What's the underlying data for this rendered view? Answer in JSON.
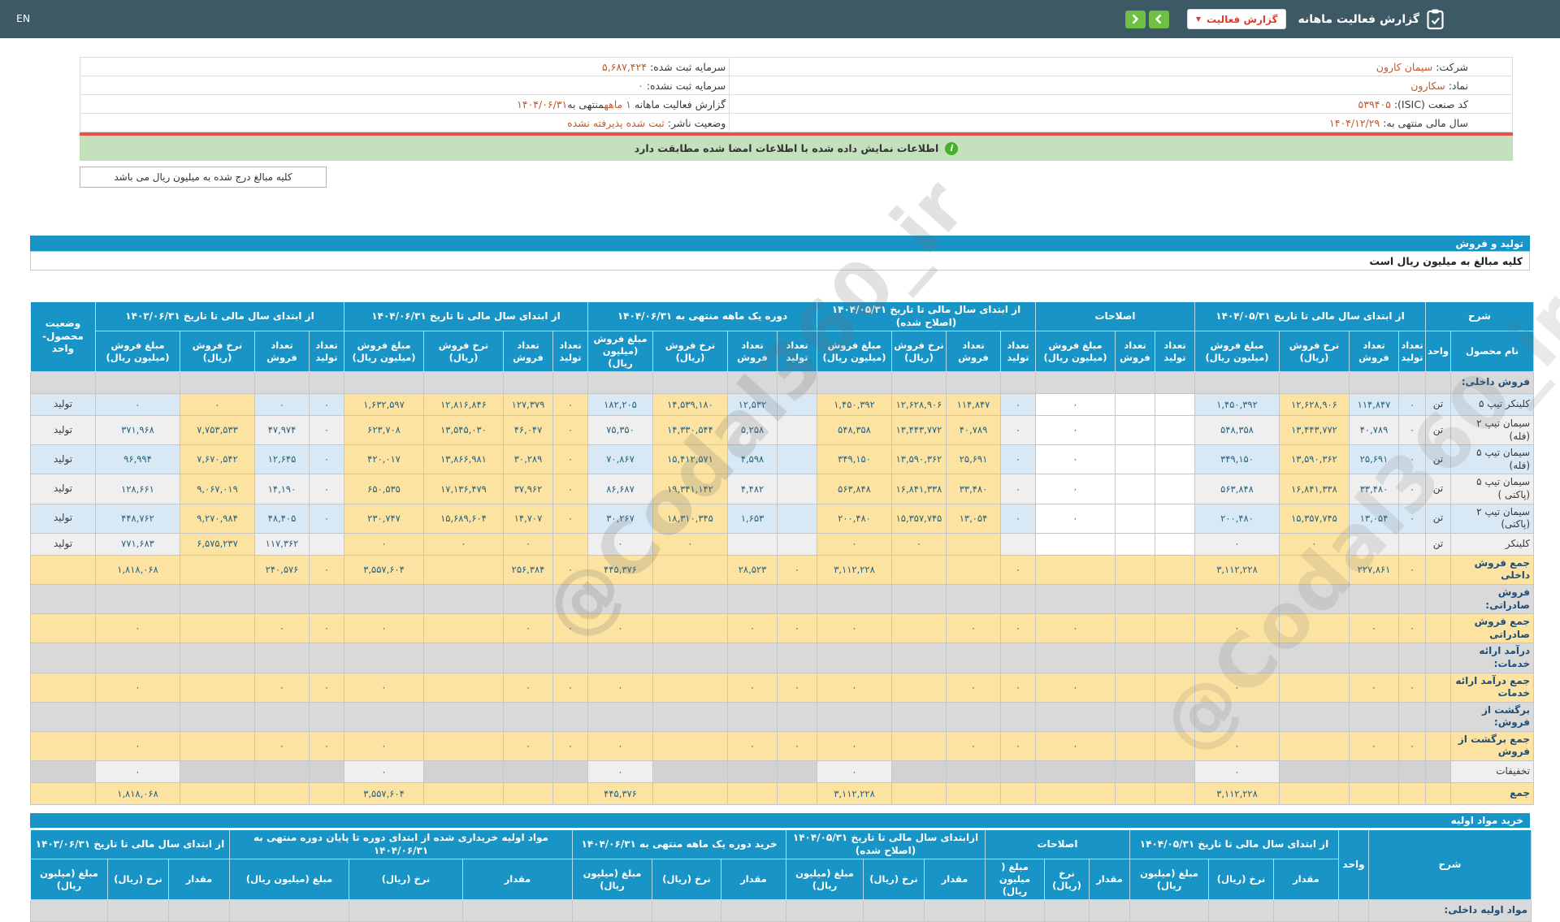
{
  "topbar": {
    "en_label": "EN",
    "title": "گزارش فعالیت ماهانه",
    "dropdown_label": "گزارش فعالیت"
  },
  "info": {
    "company_label": "شرکت:",
    "company_value": "سیمان کارون",
    "symbol_label": "نماد:",
    "symbol_value": "سکارون",
    "isic_label": "کد صنعت (ISIC):",
    "isic_value": "۵۳۹۴۰۵",
    "fiscal_label": "سال مالی منتهی به:",
    "fiscal_value": "۱۴۰۴/۱۲/۲۹",
    "registered_capital_label": "سرمایه ثبت شده:",
    "registered_capital_value": "۵,۶۸۷,۴۲۴",
    "unregistered_capital_label": "سرمایه ثبت نشده:",
    "unregistered_capital_value": "۰",
    "report_label": "گزارش فعالیت ماهانه",
    "report_duration": "۱ ماهه",
    "report_mid": "منتهی به",
    "report_date": "۱۴۰۴/۰۶/۳۱",
    "issuer_status_label": "وضعیت ناشر:",
    "issuer_status_value": "ثبت شده پذیرفته نشده"
  },
  "banner": {
    "text": "اطلاعات نمایش داده شده با اطلاعات امضا شده مطابقت دارد"
  },
  "notes": {
    "amounts_note": "کلیه مبالغ درج شده به میلیون ریال می باشد",
    "table_amounts_note": "کلیه مبالغ به میلیون ریال است"
  },
  "watermark": "@Codal360_ir",
  "colors": {
    "header_blue": "#1994c6",
    "highlight_yellow": "#fce3a1",
    "stripe_blue": "#d8e9f5",
    "stripe_gray": "#efefef",
    "green_button": "#6fbf44",
    "red_accent": "#e0392d",
    "orange_value": "#c35a2e",
    "banner_green": "#c5e0bd",
    "topbar": "#3d5966",
    "red_line": "#e4514f"
  },
  "production_section": {
    "title": "تولید و فروش",
    "header": {
      "desc": "شرح",
      "product": "نام محصول",
      "unit": "واحد",
      "status": "وضعیت محصول-واحد",
      "groups": [
        {
          "label": "از ابتدای سال مالی تا تاریخ ۱۴۰۴/۰۵/۳۱",
          "cols": [
            "تعداد تولید",
            "تعداد فروش",
            "نرخ فروش (ریال)",
            "مبلغ فروش (میلیون ریال)"
          ]
        },
        {
          "label": "اصلاحات",
          "cols": [
            "تعداد تولید",
            "تعداد فروش",
            "مبلغ فروش (میلیون ریال)"
          ]
        },
        {
          "label": "از ابتدای سال مالی تا تاریخ ۱۴۰۴/۰۵/۳۱ (اصلاح شده)",
          "cols": [
            "تعداد تولید",
            "تعداد فروش",
            "نرخ فروش (ریال)",
            "مبلغ فروش (میلیون ریال)"
          ]
        },
        {
          "label": "دوره یک ماهه منتهی به ۱۴۰۴/۰۶/۳۱",
          "cols": [
            "تعداد تولید",
            "تعداد فروش",
            "نرخ فروش (ریال)",
            "مبلغ فروش (میلیون ریال)"
          ]
        },
        {
          "label": "از ابتدای سال مالی تا تاریخ ۱۴۰۴/۰۶/۳۱",
          "cols": [
            "تعداد تولید",
            "تعداد فروش",
            "نرخ فروش (ریال)",
            "مبلغ فروش (میلیون ریال)"
          ]
        },
        {
          "label": "از ابتدای سال مالی تا تاریخ ۱۴۰۳/۰۶/۳۱",
          "cols": [
            "تعداد تولید",
            "تعداد فروش",
            "نرخ فروش (ریال)",
            "مبلغ فروش (میلیون ریال)"
          ]
        }
      ]
    },
    "rows": [
      {
        "type": "section",
        "name": "فروش داخلی:",
        "unit": "",
        "status": "",
        "cells": [
          "",
          "",
          "",
          "",
          "",
          "",
          "",
          "",
          "",
          "",
          "",
          "",
          "",
          "",
          "",
          "",
          "",
          "",
          "",
          "",
          "",
          "",
          ""
        ]
      },
      {
        "type": "product",
        "name": "کلینکر تیپ ۵",
        "unit": "تن",
        "status": "تولید",
        "cells": [
          "۰",
          "۱۱۴,۸۴۷",
          "۱۲,۶۲۸,۹۰۶",
          "۱,۴۵۰,۳۹۲",
          "",
          "",
          "۰",
          "۰",
          "۱۱۴,۸۴۷",
          "۱۲,۶۲۸,۹۰۶",
          "۱,۴۵۰,۳۹۲",
          "",
          "۱۲,۵۳۲",
          "۱۴,۵۳۹,۱۸۰",
          "۱۸۲,۲۰۵",
          "۰",
          "۱۲۷,۳۷۹",
          "۱۲,۸۱۶,۸۴۶",
          "۱,۶۳۲,۵۹۷",
          "۰",
          "۰",
          "۰",
          "۰"
        ]
      },
      {
        "type": "product",
        "name": "سیمان تیپ ۲ (فله)",
        "unit": "تن",
        "status": "تولید",
        "cells": [
          "۰",
          "۴۰,۷۸۹",
          "۱۳,۴۴۳,۷۷۲",
          "۵۴۸,۳۵۸",
          "",
          "",
          "۰",
          "۰",
          "۴۰,۷۸۹",
          "۱۳,۴۴۳,۷۷۲",
          "۵۴۸,۳۵۸",
          "",
          "۵,۲۵۸",
          "۱۴,۳۳۰,۵۴۴",
          "۷۵,۳۵۰",
          "۰",
          "۴۶,۰۴۷",
          "۱۳,۵۴۵,۰۳۰",
          "۶۲۳,۷۰۸",
          "۰",
          "۴۷,۹۷۴",
          "۷,۷۵۳,۵۳۳",
          "۳۷۱,۹۶۸"
        ]
      },
      {
        "type": "product",
        "name": "سیمان تیپ ۵ (فله)",
        "unit": "تن",
        "status": "تولید",
        "cells": [
          "۰",
          "۲۵,۶۹۱",
          "۱۳,۵۹۰,۳۶۲",
          "۳۴۹,۱۵۰",
          "",
          "",
          "۰",
          "۰",
          "۲۵,۶۹۱",
          "۱۳,۵۹۰,۳۶۲",
          "۳۴۹,۱۵۰",
          "",
          "۴,۵۹۸",
          "۱۵,۴۱۲,۵۷۱",
          "۷۰,۸۶۷",
          "۰",
          "۳۰,۲۸۹",
          "۱۳,۸۶۶,۹۸۱",
          "۴۲۰,۰۱۷",
          "۰",
          "۱۲,۶۴۵",
          "۷,۶۷۰,۵۴۲",
          "۹۶,۹۹۴"
        ]
      },
      {
        "type": "product",
        "name": "سیمان تیپ ۵ (پاکتی )",
        "unit": "تن",
        "status": "تولید",
        "cells": [
          "۰",
          "۳۳,۴۸۰",
          "۱۶,۸۴۱,۳۳۸",
          "۵۶۳,۸۴۸",
          "",
          "",
          "۰",
          "۰",
          "۳۳,۴۸۰",
          "۱۶,۸۴۱,۳۳۸",
          "۵۶۳,۸۴۸",
          "",
          "۴,۴۸۲",
          "۱۹,۳۴۱,۱۴۲",
          "۸۶,۶۸۷",
          "۰",
          "۳۷,۹۶۲",
          "۱۷,۱۳۶,۴۷۹",
          "۶۵۰,۵۳۵",
          "۰",
          "۱۴,۱۹۰",
          "۹,۰۶۷,۰۱۹",
          "۱۲۸,۶۶۱"
        ]
      },
      {
        "type": "product",
        "name": "سیمان تیپ ۲ (پاکتی)",
        "unit": "تن",
        "status": "تولید",
        "cells": [
          "۰",
          "۱۳,۰۵۴",
          "۱۵,۳۵۷,۷۴۵",
          "۲۰۰,۴۸۰",
          "",
          "",
          "۰",
          "۰",
          "۱۳,۰۵۴",
          "۱۵,۳۵۷,۷۴۵",
          "۲۰۰,۴۸۰",
          "",
          "۱,۶۵۳",
          "۱۸,۳۱۰,۳۴۵",
          "۳۰,۲۶۷",
          "۰",
          "۱۴,۷۰۷",
          "۱۵,۶۸۹,۶۰۴",
          "۲۳۰,۷۴۷",
          "۰",
          "۴۸,۴۰۵",
          "۹,۲۷۰,۹۸۴",
          "۴۴۸,۷۶۲"
        ]
      },
      {
        "type": "product",
        "name": "کلینکر",
        "unit": "تن",
        "status": "تولید",
        "cells": [
          "",
          "",
          "۰",
          "۰",
          "",
          "",
          "",
          "",
          "",
          "۰",
          "۰",
          "",
          "",
          "۰",
          "۰",
          "",
          "۰",
          "۰",
          "۰",
          "",
          "۱۱۷,۳۶۲",
          "۶,۵۷۵,۲۳۷",
          "۷۷۱,۶۸۳"
        ]
      },
      {
        "type": "total",
        "name": "جمع فروش داخلی",
        "unit": "",
        "status": "",
        "cells": [
          "۰",
          "۲۲۷,۸۶۱",
          "",
          "۳,۱۱۲,۲۲۸",
          "",
          "",
          "",
          "۰",
          "",
          "",
          "۳,۱۱۲,۲۲۸",
          "۰",
          "۲۸,۵۲۳",
          "",
          "۴۴۵,۳۷۶",
          "۰",
          "۲۵۶,۳۸۴",
          "",
          "۳,۵۵۷,۶۰۴",
          "۰",
          "۲۴۰,۵۷۶",
          "",
          "۱,۸۱۸,۰۶۸"
        ]
      },
      {
        "type": "section",
        "name": "فروش صادراتی:",
        "unit": "",
        "status": "",
        "cells": [
          "",
          "",
          "",
          "",
          "",
          "",
          "",
          "",
          "",
          "",
          "",
          "",
          "",
          "",
          "",
          "",
          "",
          "",
          "",
          "",
          "",
          "",
          ""
        ]
      },
      {
        "type": "total",
        "name": "جمع فروش صادراتی",
        "unit": "",
        "status": "",
        "cells": [
          "۰",
          "۰",
          "",
          "۰",
          "",
          "",
          "۰",
          "۰",
          "۰",
          "",
          "۰",
          "۰",
          "۰",
          "",
          "۰",
          "۰",
          "۰",
          "",
          "۰",
          "۰",
          "۰",
          "",
          "۰"
        ]
      },
      {
        "type": "section",
        "name": "درآمد ارائه خدمات:",
        "unit": "",
        "status": "",
        "cells": [
          "",
          "",
          "",
          "",
          "",
          "",
          "",
          "",
          "",
          "",
          "",
          "",
          "",
          "",
          "",
          "",
          "",
          "",
          "",
          "",
          "",
          "",
          ""
        ]
      },
      {
        "type": "total",
        "name": "جمع درآمد ارائه خدمات",
        "unit": "",
        "status": "",
        "cells": [
          "۰",
          "۰",
          "",
          "۰",
          "",
          "",
          "۰",
          "۰",
          "۰",
          "",
          "۰",
          "۰",
          "۰",
          "",
          "۰",
          "۰",
          "۰",
          "",
          "۰",
          "۰",
          "۰",
          "",
          "۰"
        ]
      },
      {
        "type": "section",
        "name": "برگشت از فروش:",
        "unit": "",
        "status": "",
        "cells": [
          "",
          "",
          "",
          "",
          "",
          "",
          "",
          "",
          "",
          "",
          "",
          "",
          "",
          "",
          "",
          "",
          "",
          "",
          "",
          "",
          "",
          "",
          ""
        ]
      },
      {
        "type": "total",
        "name": "جمع برگشت از فروش",
        "unit": "",
        "status": "",
        "cells": [
          "۰",
          "۰",
          "",
          "۰",
          "",
          "",
          "۰",
          "۰",
          "۰",
          "",
          "۰",
          "۰",
          "۰",
          "",
          "۰",
          "۰",
          "۰",
          "",
          "۰",
          "۰",
          "۰",
          "",
          "۰"
        ]
      },
      {
        "type": "discount",
        "name": "تخفیفات",
        "unit": "",
        "status": "",
        "cells": [
          "",
          "",
          "",
          "۰",
          "",
          "",
          "",
          "",
          "",
          "",
          "۰",
          "",
          "",
          "",
          "۰",
          "",
          "",
          "",
          "۰",
          "",
          "",
          "",
          "۰"
        ]
      },
      {
        "type": "total",
        "name": "جمع",
        "unit": "",
        "status": "",
        "cells": [
          "",
          "",
          "",
          "۳,۱۱۲,۲۲۸",
          "",
          "",
          "",
          "",
          "",
          "",
          "۳,۱۱۲,۲۲۸",
          "",
          "",
          "",
          "۴۴۵,۳۷۶",
          "",
          "",
          "",
          "۳,۵۵۷,۶۰۴",
          "",
          "",
          "",
          "۱,۸۱۸,۰۶۸"
        ]
      }
    ]
  },
  "purchase_section": {
    "title": "خرید مواد اولیه",
    "header": {
      "desc": "شرح",
      "unit": "واحد",
      "groups": [
        {
          "label": "از ابتدای سال مالی تا تاریخ ۱۴۰۴/۰۵/۳۱",
          "cols": [
            "مقدار",
            "نرخ (ریال)",
            "مبلغ (میلیون ریال)"
          ]
        },
        {
          "label": "اصلاحات",
          "cols": [
            "مقدار",
            "نرخ (ریال)",
            "مبلغ ( میلیون ریال)"
          ]
        },
        {
          "label": "ازابتدای سال مالی تا تاریخ ۱۴۰۴/۰۵/۳۱ (اصلاح شده)",
          "cols": [
            "مقدار",
            "نرخ (ریال)",
            "مبلغ (میلیون ریال)"
          ]
        },
        {
          "label": "خرید دوره یک ماهه منتهی به ۱۴۰۴/۰۶/۳۱",
          "cols": [
            "مقدار",
            "نرخ (ریال)",
            "مبلغ (میلیون ریال)"
          ]
        },
        {
          "label": "مواد اولیه خریداری شده از ابتدای دوره تا پایان دوره منتهی به ۱۴۰۴/۰۶/۳۱",
          "cols": [
            "مقدار",
            "نرخ (ریال)",
            "مبلغ (میلیون ریال)"
          ]
        },
        {
          "label": "از ابتدای سال مالی تا تاریخ ۱۴۰۳/۰۶/۳۱",
          "cols": [
            "مقدار",
            "نرخ (ریال)",
            "مبلغ (میلیون ریال)"
          ]
        }
      ]
    },
    "first_row_label": "مواد اولیه داخلی:"
  }
}
